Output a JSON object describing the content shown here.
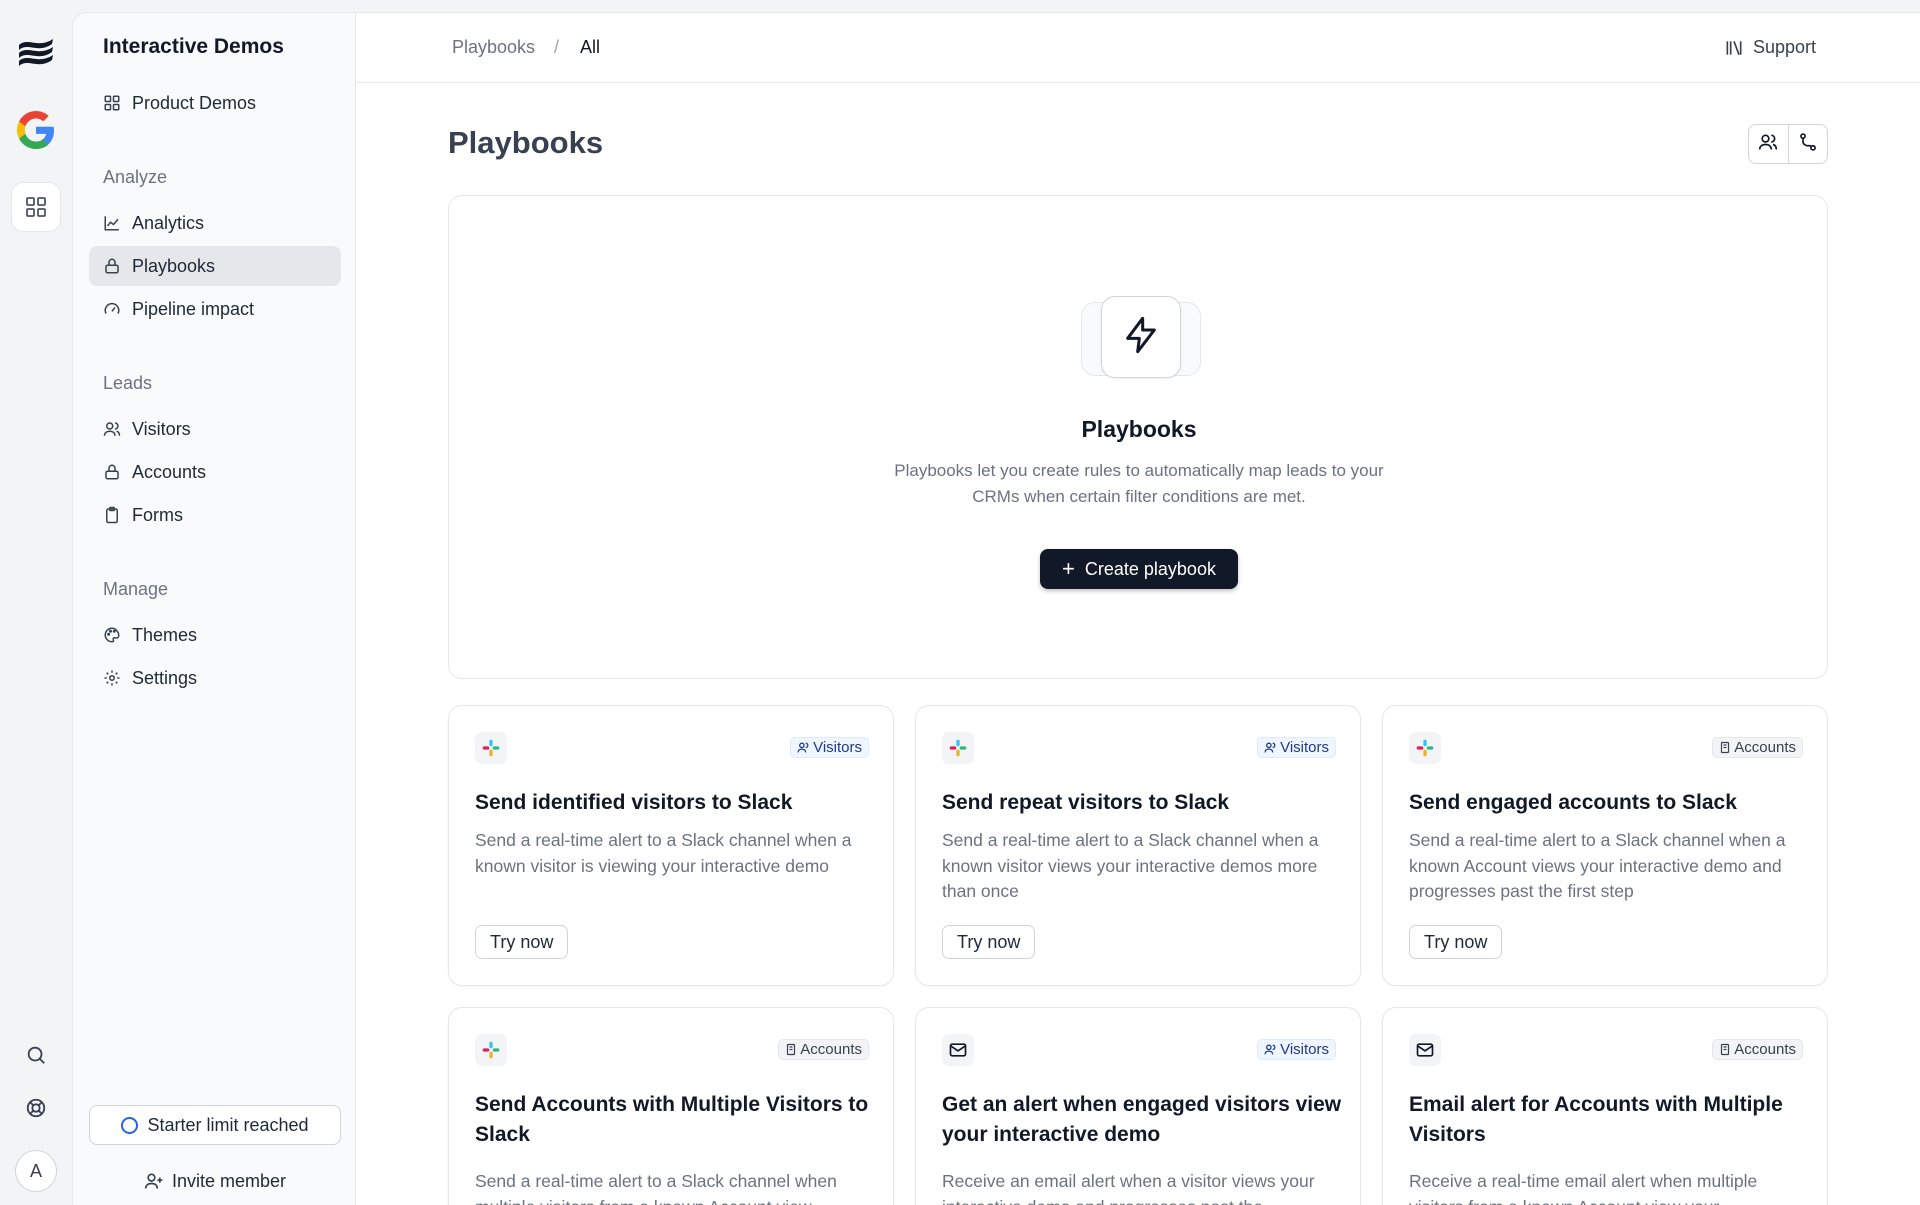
{
  "sidebar": {
    "workspace_title": "Interactive Demos",
    "top_item": "Product Demos",
    "sections": {
      "analyze": "Analyze",
      "leads": "Leads",
      "manage": "Manage"
    },
    "items": {
      "analytics": "Analytics",
      "playbooks": "Playbooks",
      "pipeline_impact": "Pipeline impact",
      "visitors": "Visitors",
      "accounts": "Accounts",
      "forms": "Forms",
      "themes": "Themes",
      "settings": "Settings"
    },
    "starter_limit": "Starter limit reached",
    "invite_member": "Invite member"
  },
  "rail": {
    "avatar_initial": "A"
  },
  "topbar": {
    "breadcrumb": [
      "Playbooks",
      "/",
      "All"
    ],
    "support": "Support"
  },
  "page": {
    "title": "Playbooks"
  },
  "hero": {
    "title": "Playbooks",
    "description": "Playbooks let you create rules to automatically map leads to your CRMs when certain filter conditions are met.",
    "create_button": "Create playbook"
  },
  "cards": [
    {
      "icon": "slack-icon",
      "badge": "Visitors",
      "title": "Send identified visitors to Slack",
      "description": "Send a real-time alert to a Slack channel when a known visitor is viewing your interactive demo",
      "button": "Try now"
    },
    {
      "icon": "slack-icon",
      "badge": "Visitors",
      "title": "Send repeat visitors to Slack",
      "description": "Send a real-time alert to a Slack channel when a known visitor views your interactive demos more than once",
      "button": "Try now"
    },
    {
      "icon": "slack-icon",
      "badge": "Accounts",
      "title": "Send engaged accounts to Slack",
      "description": "Send a real-time alert to a Slack channel when a known Account views your interactive demo and progresses past the first step",
      "button": "Try now"
    },
    {
      "icon": "slack-icon",
      "badge": "Accounts",
      "title": "Send Accounts with Multiple Visitors to Slack",
      "description": "Send a real-time alert to a Slack channel when multiple visitors from a known Account view"
    },
    {
      "icon": "mail-icon",
      "badge": "Visitors",
      "title": "Get an alert when engaged visitors view your interactive demo",
      "description": "Receive an email alert when a visitor views your interactive demo and progresses past the"
    },
    {
      "icon": "mail-icon",
      "badge": "Accounts",
      "title": "Email alert for Accounts with Multiple Visitors",
      "description": "Receive a real-time email alert when multiple visitors from a known Account view your"
    }
  ],
  "colors": {
    "primary_button": "#111827",
    "visitors_badge": "#eff6ff",
    "accounts_badge": "#f3f4f6",
    "active_nav": "#e5e7eb",
    "ring_blue": "#2563eb"
  }
}
